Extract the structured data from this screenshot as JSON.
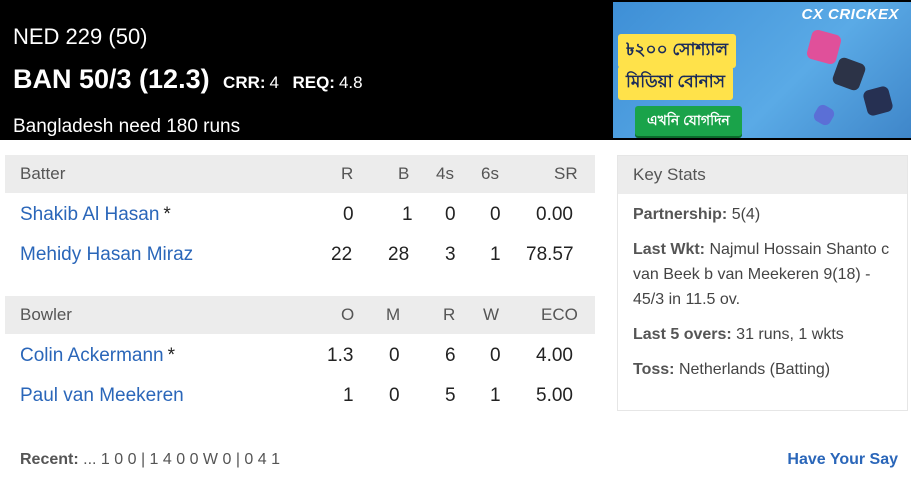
{
  "score": {
    "team1": "NED 229 (50)",
    "team2": "BAN 50/3 (12.3)",
    "crr_label": "CRR:",
    "crr_value": "4",
    "req_label": "REQ:",
    "req_value": "4.8",
    "need": "Bangladesh need 180 runs"
  },
  "ad": {
    "logo": "CX CRICKEX",
    "line1": "৳২০০ সোশ্যাল",
    "line2": "মিডিয়া বোনাস",
    "cta": "এখনি যোগদিন"
  },
  "batting": {
    "headers": [
      "Batter",
      "R",
      "B",
      "4s",
      "6s",
      "SR"
    ],
    "rows": [
      {
        "name": "Shakib Al Hasan",
        "star": "*",
        "r": "0",
        "b": "1",
        "fours": "0",
        "sixes": "0",
        "sr": "0.00"
      },
      {
        "name": "Mehidy Hasan Miraz",
        "star": "",
        "r": "22",
        "b": "28",
        "fours": "3",
        "sixes": "1",
        "sr": "78.57"
      }
    ]
  },
  "bowling": {
    "headers": [
      "Bowler",
      "O",
      "M",
      "R",
      "W",
      "ECO"
    ],
    "rows": [
      {
        "name": "Colin Ackermann",
        "star": "*",
        "o": "1.3",
        "m": "0",
        "r": "6",
        "w": "0",
        "eco": "4.00"
      },
      {
        "name": "Paul van Meekeren",
        "star": "",
        "o": "1",
        "m": "0",
        "r": "5",
        "w": "1",
        "eco": "5.00"
      }
    ]
  },
  "key_stats": {
    "title": "Key Stats",
    "partnership_label": "Partnership:",
    "partnership_value": "5(4)",
    "last_wkt_label": "Last Wkt:",
    "last_wkt_value": "Najmul Hossain Shanto c van Beek b van Meekeren 9(18) - 45/3 in 11.5 ov.",
    "last5_label": "Last 5 overs:",
    "last5_value": "31 runs, 1 wkts",
    "toss_label": "Toss:",
    "toss_value": "Netherlands (Batting)"
  },
  "footer": {
    "recent_label": "Recent:",
    "recent_value": "... 1 0 0 | 1 4 0 0 W 0 | 0 4 1",
    "have_say": "Have Your Say"
  }
}
